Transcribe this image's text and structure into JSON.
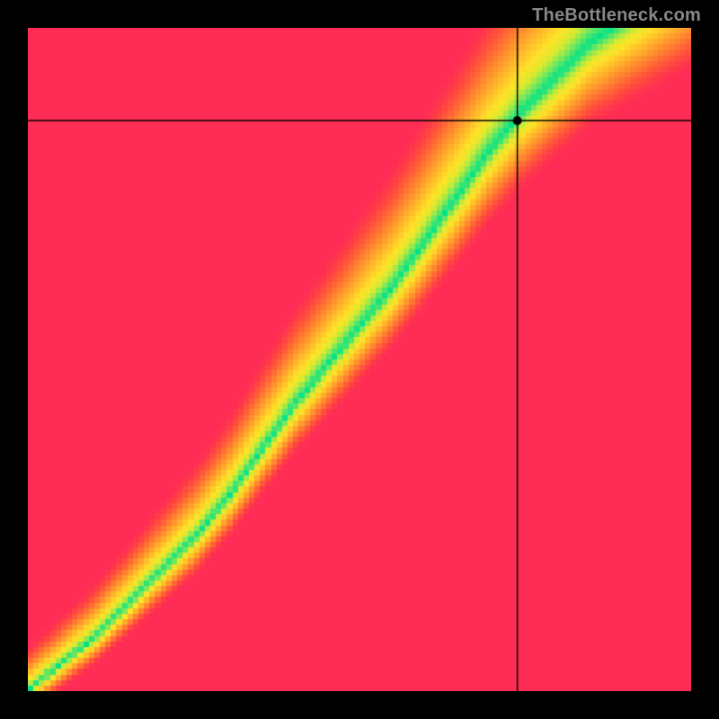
{
  "watermark": "TheBottleneck.com",
  "chart_data": {
    "type": "heatmap",
    "title": "",
    "xlabel": "",
    "ylabel": "",
    "x_range": [
      0,
      1
    ],
    "y_range": [
      0,
      1
    ],
    "crosshair": {
      "x_frac": 0.738,
      "y_frac": 0.14
    },
    "marker": {
      "x_frac": 0.738,
      "y_frac": 0.14
    },
    "optimal_curve_points": [
      {
        "x": 0.0,
        "y": 1.0
      },
      {
        "x": 0.05,
        "y": 0.96
      },
      {
        "x": 0.1,
        "y": 0.92
      },
      {
        "x": 0.15,
        "y": 0.87
      },
      {
        "x": 0.2,
        "y": 0.82
      },
      {
        "x": 0.25,
        "y": 0.77
      },
      {
        "x": 0.3,
        "y": 0.71
      },
      {
        "x": 0.35,
        "y": 0.64
      },
      {
        "x": 0.4,
        "y": 0.57
      },
      {
        "x": 0.45,
        "y": 0.51
      },
      {
        "x": 0.5,
        "y": 0.45
      },
      {
        "x": 0.55,
        "y": 0.39
      },
      {
        "x": 0.6,
        "y": 0.32
      },
      {
        "x": 0.65,
        "y": 0.25
      },
      {
        "x": 0.7,
        "y": 0.18
      },
      {
        "x": 0.75,
        "y": 0.12
      },
      {
        "x": 0.8,
        "y": 0.07
      },
      {
        "x": 0.82,
        "y": 0.05
      },
      {
        "x": 0.85,
        "y": 0.02
      },
      {
        "x": 0.88,
        "y": 0.0
      }
    ],
    "color_stops": [
      {
        "t": 0.0,
        "color": "#00e28a"
      },
      {
        "t": 0.1,
        "color": "#7de85a"
      },
      {
        "t": 0.18,
        "color": "#d8ea30"
      },
      {
        "t": 0.28,
        "color": "#ffe328"
      },
      {
        "t": 0.42,
        "color": "#ffba2a"
      },
      {
        "t": 0.58,
        "color": "#ff8a2e"
      },
      {
        "t": 0.74,
        "color": "#ff5a38"
      },
      {
        "t": 0.88,
        "color": "#ff3a48"
      },
      {
        "t": 1.0,
        "color": "#ff2d55"
      }
    ],
    "band_half_width": 0.055,
    "deviation_scale": 1.8
  }
}
